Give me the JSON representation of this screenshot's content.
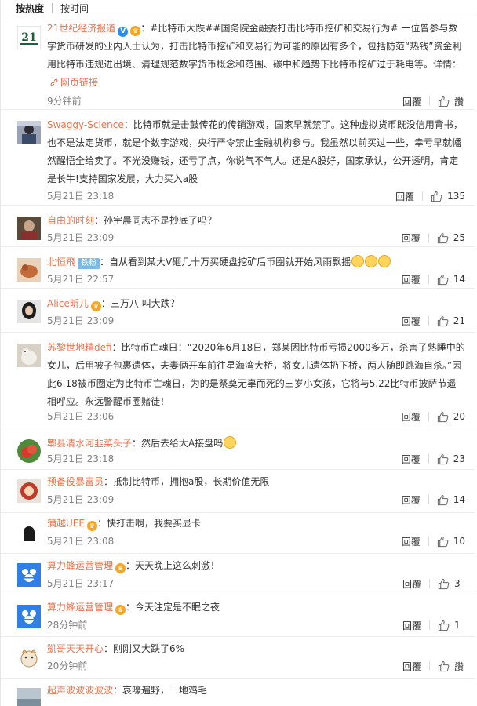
{
  "tabs": [
    {
      "label": "按热度",
      "active": true
    },
    {
      "label": "按时间",
      "active": false
    }
  ],
  "ui": {
    "reply_label": "回覆",
    "like_label": "讚",
    "weblink_label": "网页链接",
    "badge_v": "V",
    "fan_badge": "铁粉"
  },
  "comments": [
    {
      "user": "21世纪经济报道",
      "verified": true,
      "vip": true,
      "avatar_text": "21",
      "body": "：#比特币大跌##国务院金融委打击比特币挖矿和交易行为# 一位曾参与数字货币研发的业内人士认为，打击比特币挖矿和交易行为可能的原因有多个，包括防范“热钱”资金利用比特币违规进出境、清理规范数字货币概念和范围、碳中和趋势下比特币挖矿过于耗电等。详情：",
      "has_link": true,
      "time": "9分钟前",
      "likes": "讚"
    },
    {
      "user": "Swaggy-Science",
      "body": "：比特币就是击鼓传花的传销游戏，国家早就禁了。这种虚拟货币既没信用背书，也不是法定货币，就是个数字游戏，央行严令禁止金融机构参与。我虽然以前买过一些，幸亏早就幡然醒悟全给卖了。不光没赚钱，还亏了点，你说气不气人。还是A股好，国家承认，公开透明，肯定是长牛!支持国家发展，大力买入a股",
      "time": "5月21日 23:18",
      "likes": "135"
    },
    {
      "user": "自由的时刻",
      "body": "：孙宇晨同志不是抄底了吗？",
      "time": "5月21日 23:09",
      "likes": "25"
    },
    {
      "user": "北恒飛",
      "fan": true,
      "body": "：自从看到某大V砸几十万买硬盘挖矿后币圈就开始风雨飘摇",
      "emojis": 3,
      "time": "5月21日 22:57",
      "likes": "14"
    },
    {
      "user": "Alice昕儿",
      "vip": true,
      "body": "：三万八 叫大跌？",
      "time": "5月21日 23:09",
      "likes": "21"
    },
    {
      "user": "苏黎世地精defi",
      "body": "：比特币亡魂日：“2020年6月18日，郑某因比特币亏损2000多万，杀害了熟睡中的女儿，后用被子包裹遗体，夫妻俩开车前往星海湾大桥，将女儿遗体扔下桥，两人随即跳海自杀。”因此6.18被币圈定为比特币亡魂日，为的是祭奠无辜而死的三岁小女孩，它将与5.22比特币披萨节遥相呼应。永远警醒币圈赌徒！",
      "time": "5月21日 23:06",
      "likes": "20"
    },
    {
      "user": "郫县清水河韭菜头子",
      "body": "：然后去给大A接盘吗",
      "emojis": 1,
      "time": "5月21日 23:18",
      "likes": "23"
    },
    {
      "user": "预备役暴富员",
      "body": "：抵制比特币，拥抱a股，长期价值无限",
      "time": "5月21日 23:09",
      "likes": "14"
    },
    {
      "user": "蒲越UEE",
      "vip": true,
      "body": "：快打击啊，我要买显卡",
      "time": "5月21日 23:08",
      "likes": "10"
    },
    {
      "user": "算力蜂运营管理",
      "vip": true,
      "body": "：天天晚上这么刺激！",
      "time": "5月21日 23:17",
      "likes": "3"
    },
    {
      "user": "算力蜂运营管理",
      "vip": true,
      "body": "：今天注定是不眠之夜",
      "time": "28分钟前",
      "likes": "1"
    },
    {
      "user": "凱哥天天开心",
      "body": "：刚刚又大跌了6%",
      "time": "20分钟前",
      "likes": "讚"
    },
    {
      "user": "超声波波波波波",
      "body": "：哀嚎遍野，一地鸡毛",
      "time": "",
      "likes": ""
    }
  ],
  "colors": {
    "username": "#eb7350",
    "time": "#808080",
    "verified": "#2a8eea",
    "divider": "#ececec"
  }
}
